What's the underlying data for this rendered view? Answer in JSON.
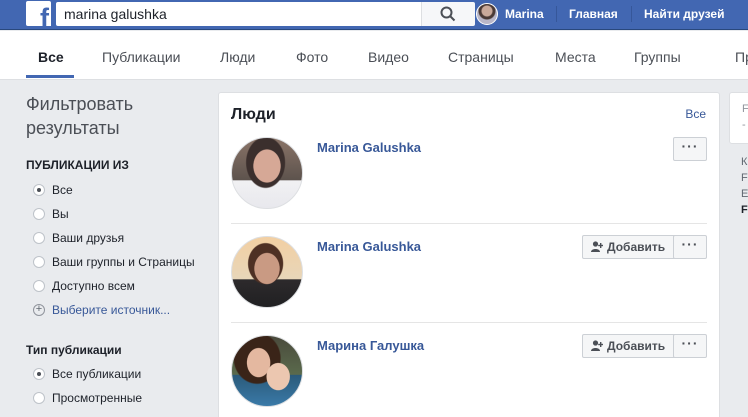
{
  "header": {
    "search_value": "marina galushka",
    "profile_name": "Marina",
    "home": "Главная",
    "find_friends": "Найти друзей",
    "brand_color": "#4267b2"
  },
  "tabs": [
    "Все",
    "Публикации",
    "Люди",
    "Фото",
    "Видео",
    "Страницы",
    "Места",
    "Группы",
    "При"
  ],
  "filter": {
    "title": "Фильтровать результаты",
    "sec1_title": "ПУБЛИКАЦИИ ИЗ",
    "sec1_options": [
      "Все",
      "Вы",
      "Ваши друзья",
      "Ваши группы и Страницы",
      "Доступно всем"
    ],
    "choose_source": "Выберите источник...",
    "sec2_title": "Тип публикации",
    "sec2_options": [
      "Все публикации",
      "Просмотренные"
    ]
  },
  "people": {
    "title": "Люди",
    "see_all": "Все",
    "add_label": "Добавить",
    "more_label": "···",
    "results": [
      {
        "name": "Marina Galushka",
        "has_add_button": false
      },
      {
        "name": "Marina Galushka",
        "has_add_button": true
      },
      {
        "name": "Марина Галушка",
        "has_add_button": true
      }
    ]
  },
  "right_panel": {
    "lines": [
      "F",
      "-",
      "К",
      "F",
      "E",
      "F"
    ]
  }
}
